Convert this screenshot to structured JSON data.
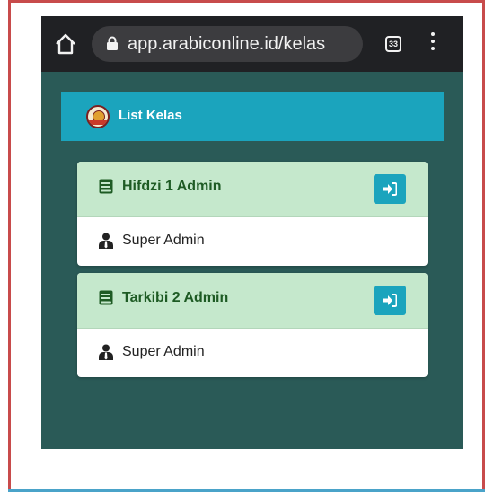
{
  "browser": {
    "url": "app.arabiconline.id/kelas",
    "tab_count": "33"
  },
  "header": {
    "title": "List Kelas"
  },
  "classes": [
    {
      "name": "Hifdzi 1 Admin",
      "owner": "Super Admin"
    },
    {
      "name": "Tarkibi 2 Admin",
      "owner": "Super Admin"
    }
  ],
  "colors": {
    "page_bg": "#2a5a57",
    "header_bg": "#1ba4bd",
    "card_head_bg": "#c5e8cc",
    "card_title": "#1e5b24",
    "button_bg": "#1ba4bd",
    "browser_bar": "#202124"
  },
  "icons": {
    "home": "home-icon",
    "lock": "lock-icon",
    "menu": "more-vert-icon",
    "book": "book-icon",
    "enter": "sign-in-icon",
    "user": "user-tie-icon",
    "logo": "arabic-online-logo"
  }
}
